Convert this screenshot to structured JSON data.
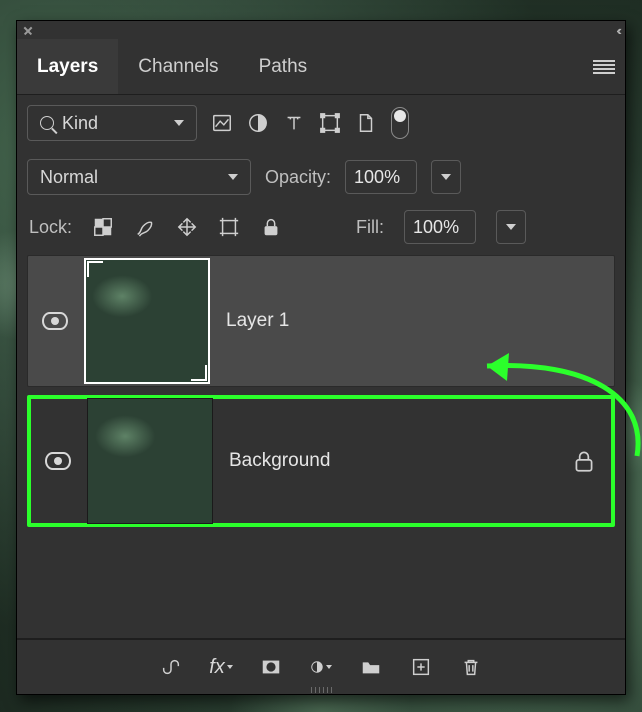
{
  "tabs": {
    "layers": "Layers",
    "channels": "Channels",
    "paths": "Paths",
    "active": "layers"
  },
  "filter": {
    "kind_label": "Kind"
  },
  "blend": {
    "mode": "Normal",
    "opacity_label": "Opacity:",
    "opacity_value": "100%"
  },
  "lock": {
    "label": "Lock:",
    "fill_label": "Fill:",
    "fill_value": "100%"
  },
  "layers": [
    {
      "name": "Layer 1",
      "visible": true,
      "locked": false,
      "selected": true
    },
    {
      "name": "Background",
      "visible": true,
      "locked": true,
      "selected": false,
      "highlighted": true
    }
  ],
  "colors": {
    "panel_bg": "#323232",
    "annotation_green": "#2bff2b"
  }
}
